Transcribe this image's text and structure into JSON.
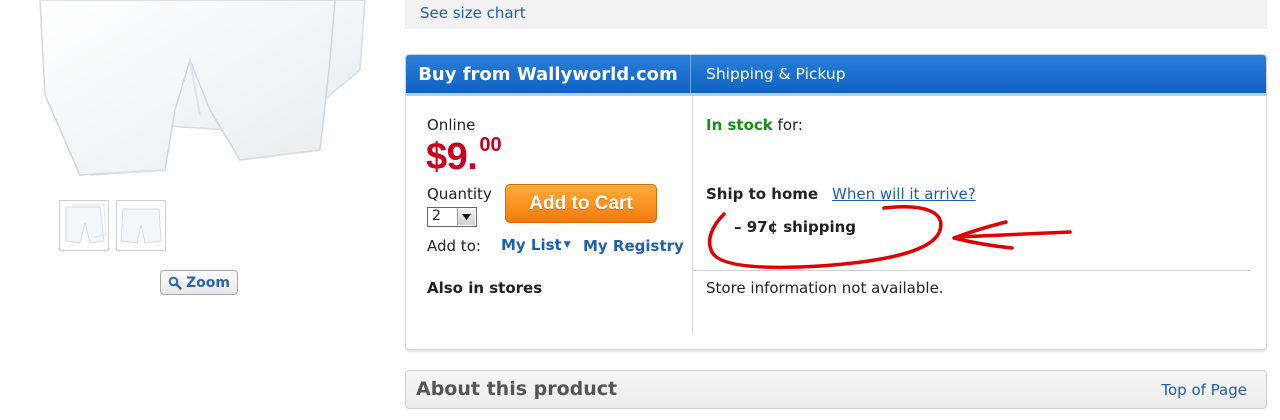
{
  "product_images": {
    "main_alt": "boxer shorts",
    "thumbnails": [
      "thumbnail-1",
      "thumbnail-2"
    ],
    "zoom_label": "Zoom",
    "zoom_icon": "magnifier-icon"
  },
  "size_chart": {
    "link_label": "See size chart"
  },
  "buybox": {
    "tabs": {
      "buy": "Buy from Wallyworld.com",
      "ship": "Shipping & Pickup"
    },
    "online_label": "Online",
    "price": {
      "main": "$9.",
      "cents": "00"
    },
    "quantity_label": "Quantity",
    "quantity_value": "2",
    "add_to_cart_label": "Add to Cart",
    "add_to_label": "Add to:",
    "my_list_label": "My List",
    "my_registry_label": "My Registry",
    "also_in_stores_label": "Also in stores",
    "stock": {
      "status": "In stock",
      "suffix": " for:"
    },
    "ship_to_home_label": "Ship to home",
    "when_arrive_link": "When will it arrive?",
    "shipping_cost": "– 97¢ shipping",
    "store_info": "Store information not available."
  },
  "about": {
    "title": "About this product",
    "top_link": "Top of Page"
  },
  "colors": {
    "header_blue": "#0d62c5",
    "price_red": "#c8001e",
    "in_stock_green": "#1a8d1a",
    "cart_orange": "#f47a09",
    "link_blue": "#1f5fb0",
    "annotation_red": "#e00000"
  }
}
